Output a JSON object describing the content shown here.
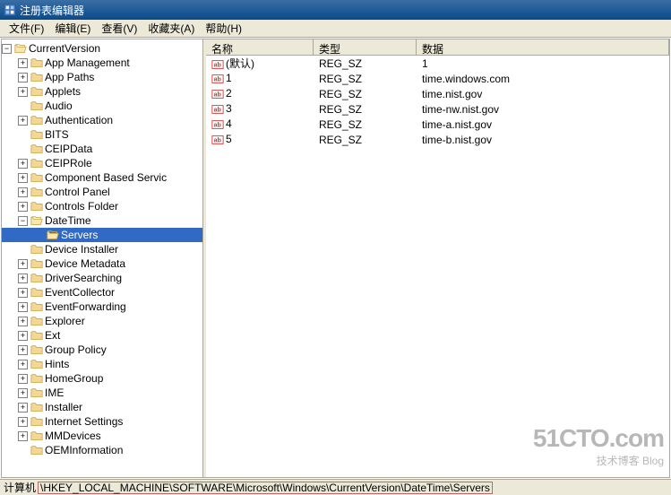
{
  "title": "注册表编辑器",
  "menus": [
    "文件(F)",
    "编辑(E)",
    "查看(V)",
    "收藏夹(A)",
    "帮助(H)"
  ],
  "tree": {
    "root": "CurrentVersion",
    "items": [
      {
        "label": "App Management",
        "expandable": true
      },
      {
        "label": "App Paths",
        "expandable": true
      },
      {
        "label": "Applets",
        "expandable": true
      },
      {
        "label": "Audio",
        "expandable": false
      },
      {
        "label": "Authentication",
        "expandable": true
      },
      {
        "label": "BITS",
        "expandable": false
      },
      {
        "label": "CEIPData",
        "expandable": false
      },
      {
        "label": "CEIPRole",
        "expandable": true
      },
      {
        "label": "Component Based Servic",
        "expandable": true
      },
      {
        "label": "Control Panel",
        "expandable": true
      },
      {
        "label": "Controls Folder",
        "expandable": true
      },
      {
        "label": "DateTime",
        "expandable": true,
        "expanded": true,
        "children": [
          {
            "label": "Servers",
            "selected": true
          }
        ]
      },
      {
        "label": "Device Installer",
        "expandable": false
      },
      {
        "label": "Device Metadata",
        "expandable": true
      },
      {
        "label": "DriverSearching",
        "expandable": true
      },
      {
        "label": "EventCollector",
        "expandable": true
      },
      {
        "label": "EventForwarding",
        "expandable": true
      },
      {
        "label": "Explorer",
        "expandable": true
      },
      {
        "label": "Ext",
        "expandable": true
      },
      {
        "label": "Group Policy",
        "expandable": true
      },
      {
        "label": "Hints",
        "expandable": true
      },
      {
        "label": "HomeGroup",
        "expandable": true
      },
      {
        "label": "IME",
        "expandable": true
      },
      {
        "label": "Installer",
        "expandable": true
      },
      {
        "label": "Internet Settings",
        "expandable": true
      },
      {
        "label": "MMDevices",
        "expandable": true
      },
      {
        "label": "OEMInformation",
        "expandable": false
      }
    ]
  },
  "list": {
    "headers": {
      "name": "名称",
      "type": "类型",
      "data": "数据"
    },
    "rows": [
      {
        "name": "(默认)",
        "type": "REG_SZ",
        "data": "1"
      },
      {
        "name": "1",
        "type": "REG_SZ",
        "data": "time.windows.com"
      },
      {
        "name": "2",
        "type": "REG_SZ",
        "data": "time.nist.gov"
      },
      {
        "name": "3",
        "type": "REG_SZ",
        "data": "time-nw.nist.gov"
      },
      {
        "name": "4",
        "type": "REG_SZ",
        "data": "time-a.nist.gov"
      },
      {
        "name": "5",
        "type": "REG_SZ",
        "data": "time-b.nist.gov"
      }
    ]
  },
  "status": {
    "label": "计算机",
    "path": "\\HKEY_LOCAL_MACHINE\\SOFTWARE\\Microsoft\\Windows\\CurrentVersion\\DateTime\\Servers"
  },
  "watermark": {
    "main": "51CTO.com",
    "sub": "技术博客   Blog"
  }
}
